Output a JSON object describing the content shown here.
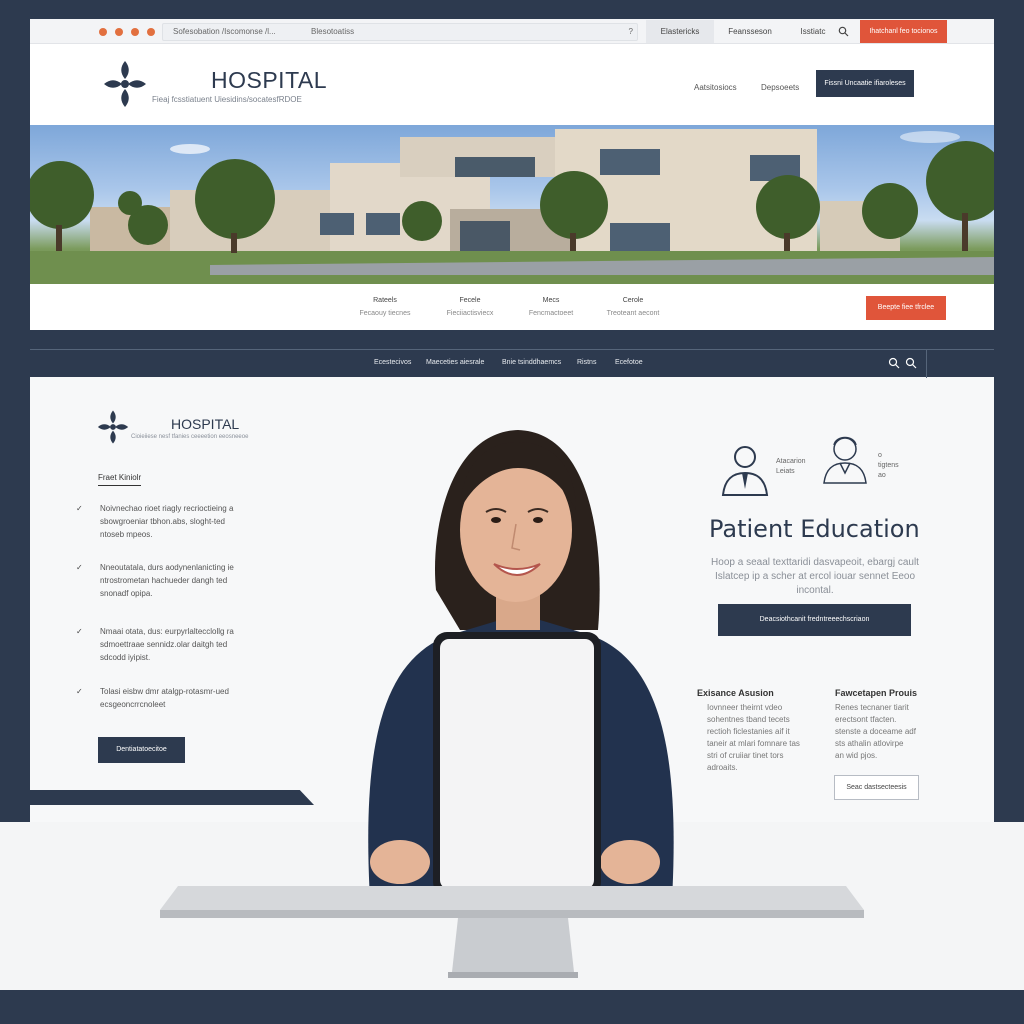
{
  "colors": {
    "navy": "#2d3a4f",
    "accent": "#e0553a",
    "white": "#ffffff"
  },
  "top_window": {
    "url_segment_1": "Sofesobation /Iscomonse /l...",
    "url_segment_2": "Blesotoatiss",
    "url_segment_3": "?",
    "chrome_tabs": [
      "Elastericks",
      "Feansseson",
      "Isstiatc"
    ],
    "chrome_cta": "Ihatchanl feo tocionos",
    "brand_title": "HOSPITAL",
    "brand_subtitle": "Fieaj fcsstiatuent Uiesidins/socatesfRDOE",
    "header_links": [
      "Aatsitosiocs",
      "Depsoeets"
    ],
    "header_button": "Fissni Uncaatie ifiaroleses",
    "subnav": [
      {
        "label": "Rateels",
        "sub": "Fecaouy tiecnes"
      },
      {
        "label": "Fecele",
        "sub": "Fieciiactisviecx"
      },
      {
        "label": "Mecs",
        "sub": "Fencmactoeet"
      },
      {
        "label": "Cerole",
        "sub": "Treoteant aecont"
      }
    ],
    "hero_cta": "Beepte fiee tfrclee"
  },
  "bottom_window": {
    "nav_items": [
      "Ecestecivos",
      "Maeceties aiesrale",
      "Bnie tsinddhaemcs",
      "Ristns",
      "Ecefotoe"
    ],
    "brand_title": "HOSPITAL",
    "brand_subtitle": "Cioieiiese nesf tfanies ceeeetion eeosneeoe",
    "section_label": "Fraet Kiniolr",
    "bullets": [
      {
        "l1": "Noivnechao rioet riagly recrioctieing a",
        "l2": "sbowgroeniar tbhon.abs, sloght-ted",
        "l3": "ntoseb mpeos."
      },
      {
        "l1": "Nneoutatala, durs aodynenlanicting ie",
        "l2": "ntrostrometan hachueder dangh ted",
        "l3": "snonadf opipa."
      },
      {
        "l1": "Nmaai otata, dus: eurpyrlaltecclollg ra",
        "l2": "sdmoettraae sennidz.olar daitgh ted",
        "l3": "sdcodd iyipist."
      },
      {
        "l1": "Tolasi eisbw dmr atalgp-rotasmr-ued",
        "l2": "ecsgeoncrrcnoleet",
        "l3": ""
      }
    ],
    "left_button": "Dentiatatoecitoe",
    "icon_caption_1": [
      "Atacarion",
      "Leiats"
    ],
    "icon_caption_2": [
      "o",
      "tigtens",
      "ao"
    ],
    "pe_title": "Patient Education",
    "pe_body": "Hoop a seaal texttaridi dasvapeoit, ebargj cault Islatcep ip a scher at ercol iouar sennet Eeoo incontal.",
    "pe_button": "Deacsiothcanit fredntreeechscriaon",
    "col1_title": "Exisance Asusion",
    "col1_body": [
      "Iovnneer theirnt vdeo",
      "sohentnes tband tecets",
      "rectioh ficlestanies aif it",
      "taneir at mlari fomnare tas",
      "stri of cruiiar tinet tors",
      "adroaits."
    ],
    "col2_title": "Fawcetapen Prouis",
    "col2_body": [
      "Renes tecnaner tiarit",
      "erectsont tfacten.",
      "stenste a doceame adf",
      "sts athalin atlovirpe",
      "an wid pjos."
    ],
    "outline_button": "Seac dastsecteesis"
  }
}
